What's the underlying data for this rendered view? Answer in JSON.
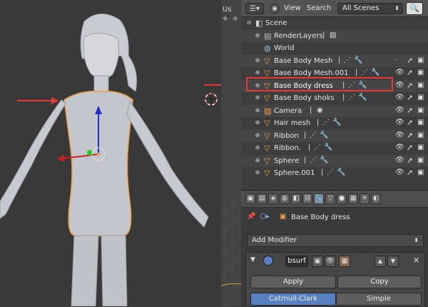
{
  "viewport": {
    "strip_label": "Us",
    "object_name": "Base Body dress"
  },
  "outliner": {
    "editor_icon": "outliner-icon",
    "menus": [
      "View",
      "Search"
    ],
    "scene_filter": "All Scenes",
    "rows": [
      {
        "label": "Scene",
        "indent": 0,
        "kind": "scene"
      },
      {
        "label": "RenderLayers",
        "indent": 1,
        "kind": "renderlayers"
      },
      {
        "label": "World",
        "indent": 1,
        "kind": "world"
      },
      {
        "label": "Base Body Mesh",
        "indent": 1,
        "kind": "mesh"
      },
      {
        "label": "Base Body Mesh.001",
        "indent": 1,
        "kind": "mesh"
      },
      {
        "label": "Base Body dress",
        "indent": 1,
        "kind": "mesh",
        "selected": true
      },
      {
        "label": "Base Body shoks",
        "indent": 1,
        "kind": "mesh"
      },
      {
        "label": "Camera",
        "indent": 1,
        "kind": "camera"
      },
      {
        "label": "Hair mesh",
        "indent": 1,
        "kind": "mesh"
      },
      {
        "label": "Ribbon",
        "indent": 1,
        "kind": "mesh"
      },
      {
        "label": "Ribbon.",
        "indent": 1,
        "kind": "mesh"
      },
      {
        "label": "Sphere",
        "indent": 1,
        "kind": "mesh"
      },
      {
        "label": "Sphere.001",
        "indent": 1,
        "kind": "mesh"
      }
    ]
  },
  "properties": {
    "breadcrumb_object": "Base Body dress",
    "add_modifier_label": "Add Modifier",
    "modifier": {
      "name": "bsurf",
      "apply_label": "Apply",
      "copy_label": "Copy",
      "mode_catmull": "Catmull-Clark",
      "mode_simple": "Simple"
    }
  },
  "colors": {
    "highlight_box": "#e53935",
    "active_blue": "#5680c2",
    "mesh_orange": "#f0a040"
  }
}
